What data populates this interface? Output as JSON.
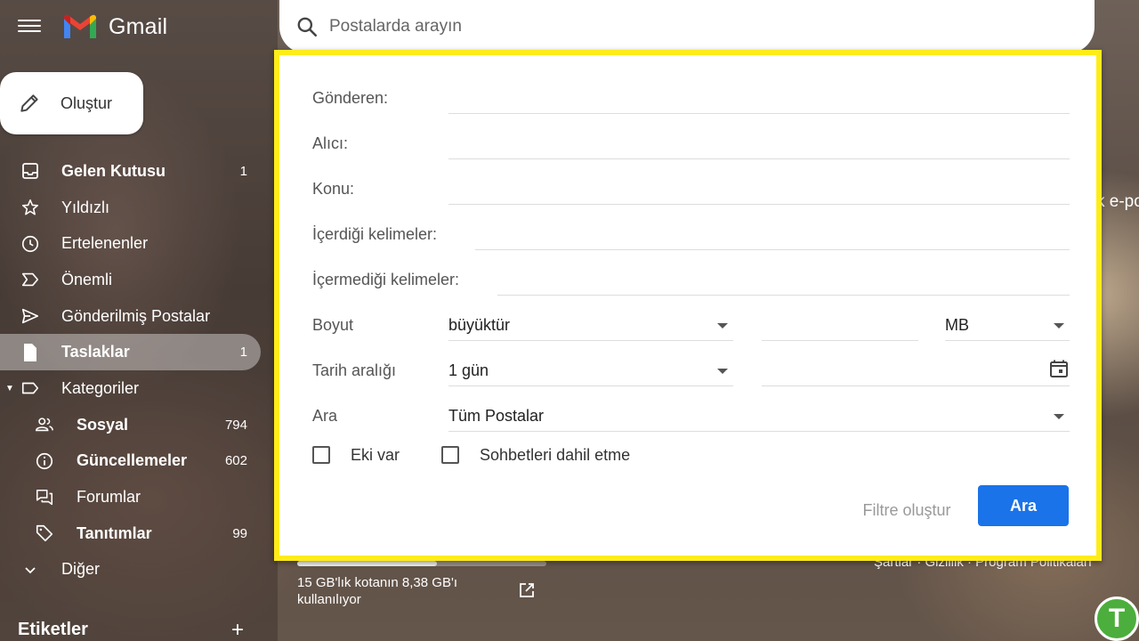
{
  "app": {
    "name": "Gmail"
  },
  "search": {
    "placeholder": "Postalarda arayın"
  },
  "compose": {
    "label": "Oluştur"
  },
  "nav": {
    "items": [
      {
        "label": "Gelen Kutusu",
        "count": "1"
      },
      {
        "label": "Yıldızlı",
        "count": ""
      },
      {
        "label": "Ertelenenler",
        "count": ""
      },
      {
        "label": "Önemli",
        "count": ""
      },
      {
        "label": "Gönderilmiş Postalar",
        "count": ""
      },
      {
        "label": "Taslaklar",
        "count": "1"
      },
      {
        "label": "Kategoriler",
        "count": ""
      },
      {
        "label": "Sosyal",
        "count": "794"
      },
      {
        "label": "Güncellemeler",
        "count": "602"
      },
      {
        "label": "Forumlar",
        "count": ""
      },
      {
        "label": "Tanıtımlar",
        "count": "99"
      },
      {
        "label": "Diğer",
        "count": ""
      }
    ],
    "labels_header": "Etiketler",
    "labels_add": "+"
  },
  "advanced": {
    "from_label": "Gönderen:",
    "to_label": "Alıcı:",
    "subject_label": "Konu:",
    "has_words_label": "İçerdiği kelimeler:",
    "no_words_label": "İçermediği kelimeler:",
    "size_label": "Boyut",
    "size_op": "büyüktür",
    "size_unit": "MB",
    "date_label": "Tarih aralığı",
    "date_value": "1 gün",
    "search_in_label": "Ara",
    "search_in_value": "Tüm Postalar",
    "has_attachment": "Eki var",
    "exclude_chats": "Sohbetleri dahil etme",
    "create_filter": "Filtre oluştur",
    "search_button": "Ara"
  },
  "storage": {
    "text": "15 GB'lık kotanın 8,38 GB'ı kullanılıyor",
    "used_fraction": 0.56
  },
  "footer": {
    "links": "Şartlar · Gizlilik · Program Politikaları"
  },
  "peek_text": "k e-po",
  "watermark": "T",
  "colors": {
    "accent": "#1a73e8",
    "highlight": "#ffec1a"
  }
}
